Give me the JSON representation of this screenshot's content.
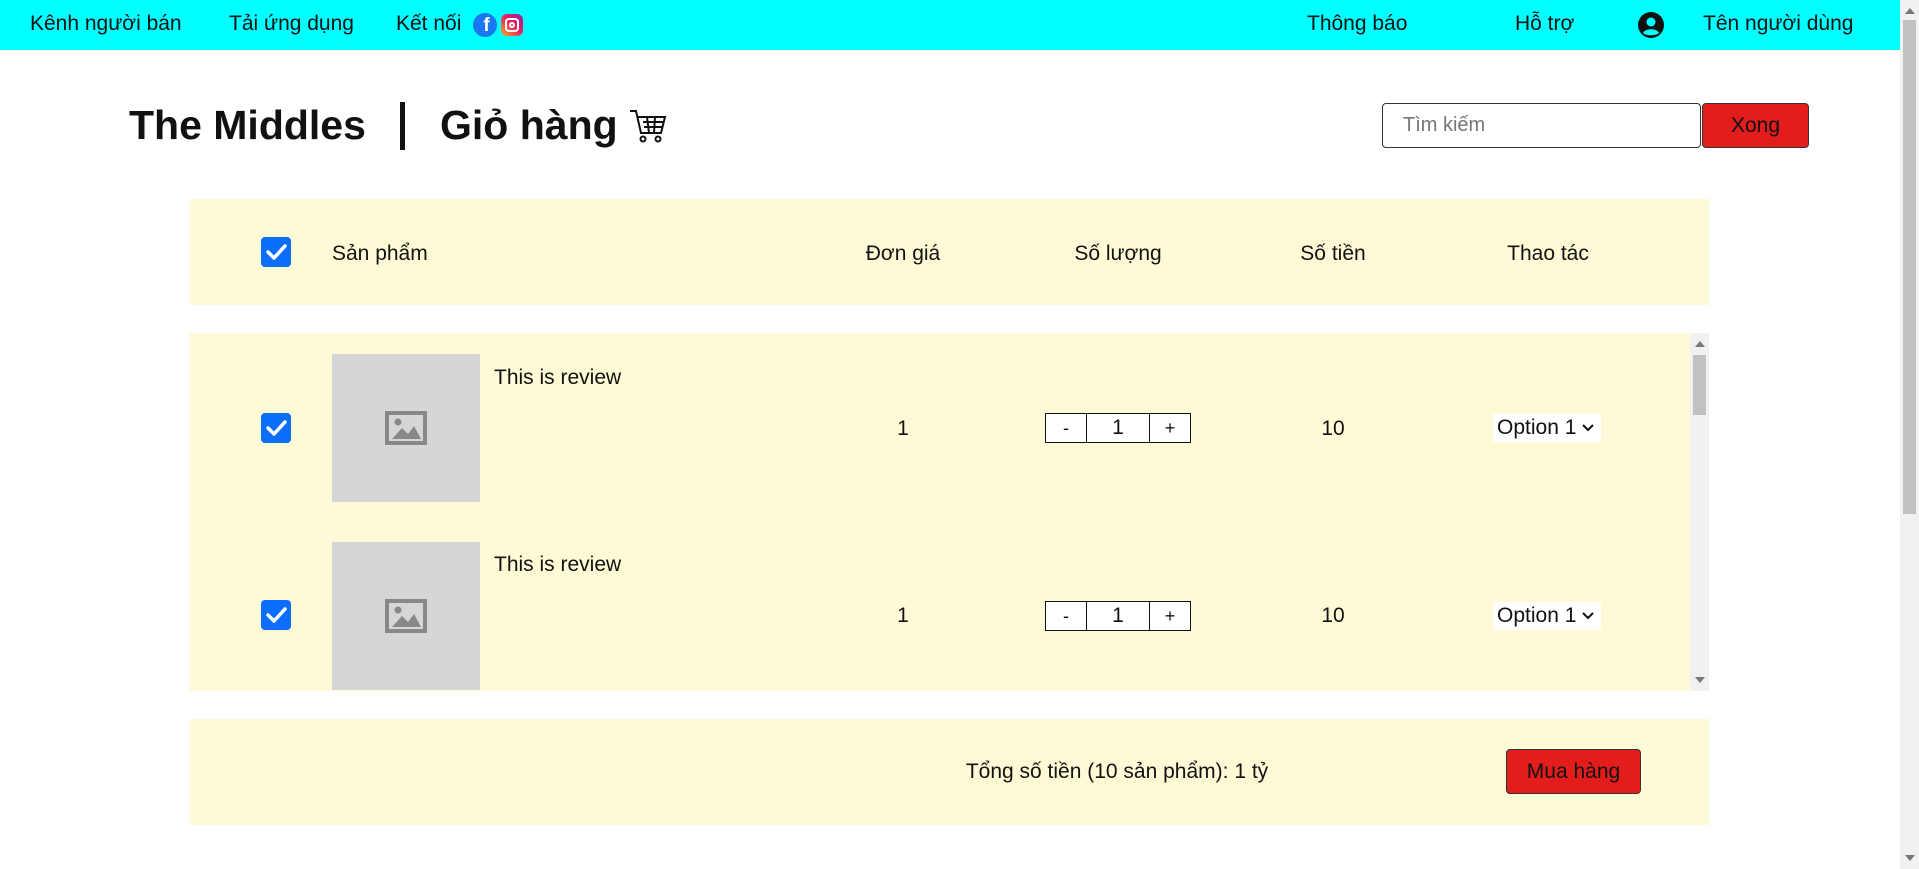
{
  "topbar": {
    "seller_channel": "Kênh người bán",
    "download_app": "Tải ứng dụng",
    "connect": "Kết nối",
    "notifications": "Thông báo",
    "support": "Hỗ trợ",
    "username": "Tên người dùng",
    "background_color": "#00ffff"
  },
  "header": {
    "brand": "The Middles",
    "title": "Giỏ hàng",
    "search_placeholder": "Tìm kiếm",
    "search_button": "Xong"
  },
  "table": {
    "columns": {
      "product": "Sản phẩm",
      "unit_price": "Đơn giá",
      "quantity": "Số lượng",
      "amount": "Số tiền",
      "actions": "Thao tác"
    },
    "select_all_checked": true,
    "rows": [
      {
        "name": "This is review",
        "unit_price": "1",
        "quantity": "1",
        "amount": "10",
        "action": "Option 1",
        "checked": true
      },
      {
        "name": "This is review",
        "unit_price": "1",
        "quantity": "1",
        "amount": "10",
        "action": "Option 1",
        "checked": true
      }
    ],
    "stepper_minus": "-",
    "stepper_plus": "+"
  },
  "footer": {
    "total_text": "Tổng số tiền (10 sản phẩm): 1 tỷ",
    "buy_button": "Mua hàng"
  },
  "colors": {
    "panel_bg": "#fffad6",
    "accent_red": "#e31c1c",
    "checkbox_blue": "#0d6efd"
  }
}
